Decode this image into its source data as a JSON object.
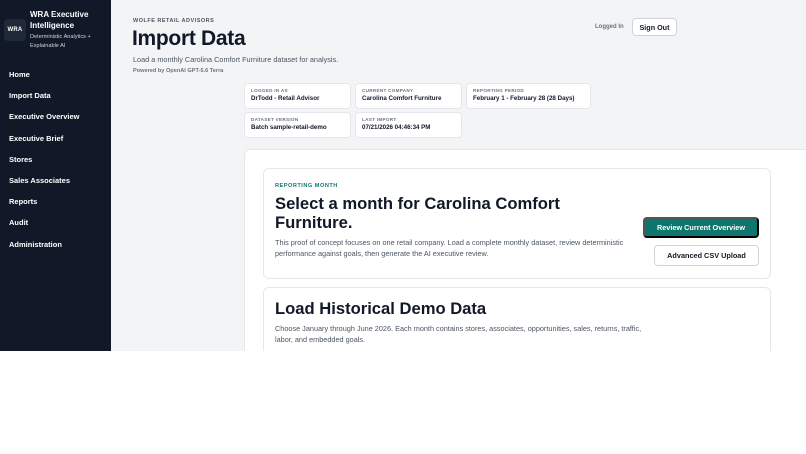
{
  "sidebar": {
    "logo_text": "WRA",
    "brand_title": "WRA Executive Intelligence",
    "brand_subtitle": "Deterministic Analytics + Explainable AI",
    "items": [
      {
        "label": "Home"
      },
      {
        "label": "Import Data"
      },
      {
        "label": "Executive Overview"
      },
      {
        "label": "Executive Brief"
      },
      {
        "label": "Stores"
      },
      {
        "label": "Sales Associates"
      },
      {
        "label": "Reports"
      },
      {
        "label": "Audit"
      },
      {
        "label": "Administration"
      }
    ]
  },
  "header": {
    "eyebrow": "WOLFE RETAIL ADVISORS",
    "title": "Import Data",
    "intro": "Load a monthly Carolina Comfort Furniture dataset for analysis.",
    "powered_by": "Powered by OpenAI GPT-5.6 Terra",
    "logged_in_label": "Logged In",
    "sign_out_label": "Sign Out"
  },
  "meta": {
    "logged_in_as": {
      "label": "LOGGED IN AS",
      "value": "DrTodd - Retail Advisor"
    },
    "current_company": {
      "label": "CURRENT COMPANY",
      "value": "Carolina Comfort Furniture"
    },
    "reporting_period": {
      "label": "REPORTING PERIOD",
      "value": "February 1 - February 28 (28 Days)"
    },
    "dataset_version": {
      "label": "DATASET VERSION",
      "value": "Batch sample-retail-demo"
    },
    "last_import": {
      "label": "LAST IMPORT",
      "value": "07/21/2026 04:46:34 PM"
    }
  },
  "reporting_month": {
    "label": "REPORTING MONTH",
    "title": "Select a month for Carolina Comfort Furniture.",
    "description": "This proof of concept focuses on one retail company. Load a complete monthly dataset, review deterministic performance against goals, then generate the AI executive review.",
    "primary_button": "Review Current Overview",
    "secondary_button": "Advanced CSV Upload"
  },
  "historical": {
    "title": "Load Historical Demo Data",
    "description": "Choose January through June 2026. Each month contains stores, associates, opportunities, sales, returns, traffic, labor, and embedded goals."
  },
  "colors": {
    "sidebar_bg": "#111827",
    "accent": "#0f766e",
    "page_bg": "#f3f4f6"
  }
}
